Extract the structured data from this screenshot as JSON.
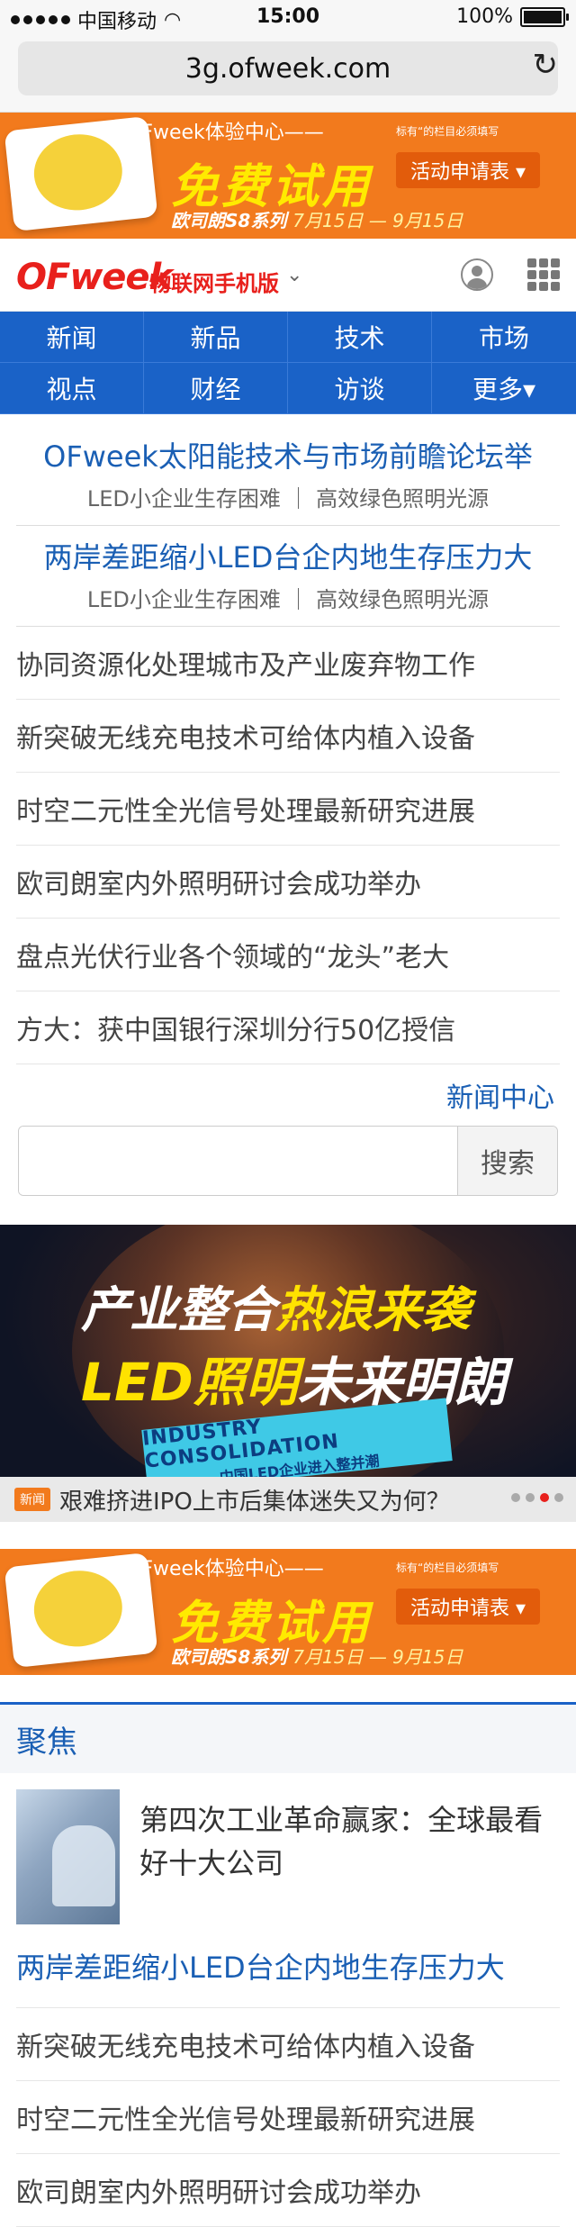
{
  "status": {
    "carrier": "中国移动",
    "time": "15:00",
    "battery": "100%"
  },
  "browser": {
    "url": "3g.ofweek.com"
  },
  "banner": {
    "line1": "OFweek体验中心——",
    "headline": "免费试用",
    "series": "欧司朗S8系列",
    "dates": "7月15日 — 9月15日",
    "note": "标有“的栏目必须填写",
    "cta": "活动申请表 ▾"
  },
  "header": {
    "logo": "OFweek",
    "site": "物联网手机版"
  },
  "nav": [
    "新闻",
    "新品",
    "技术",
    "市场",
    "视点",
    "财经",
    "访谈",
    "更多▾"
  ],
  "headlines": [
    {
      "title": "OFweek太阳能技术与市场前瞻论坛举",
      "sub": "LED小企业生存困难 ｜ 高效绿色照明光源"
    },
    {
      "title": "两岸差距缩小LED台企内地生存压力大",
      "sub": "LED小企业生存困难 ｜ 高效绿色照明光源"
    }
  ],
  "news": [
    "协同资源化处理城市及产业废弃物工作",
    "新突破无线充电技术可给体内植入设备",
    "时空二元性全光信号处理最新研究进展",
    "欧司朗室内外照明研讨会成功举办",
    "盘点光伏行业各个领域的“龙头”老大",
    "方大：获中国银行深圳分行50亿授信"
  ],
  "more_link": "新闻中心",
  "search": {
    "button": "搜索",
    "value": ""
  },
  "slider": {
    "line1a": "产业整合",
    "line1b": "热浪来袭",
    "line2a": "LED照明",
    "line2b": "未来明朗",
    "ribbon_en": "INDUSTRY CONSOLIDATION",
    "ribbon_cn": "中国LED企业进入整并潮",
    "tag": "新闻",
    "caption": "艰难挤进IPO上市后集体迷失又为何？"
  },
  "focus": {
    "title": "聚焦",
    "feature": "第四次工业革命赢家：全球最看好十大公司",
    "items": [
      "两岸差距缩小LED台企内地生存压力大",
      "新突破无线充电技术可给体内植入设备",
      "时空二元性全光信号处理最新研究进展",
      "欧司朗室内外照明研讨会成功举办"
    ]
  }
}
